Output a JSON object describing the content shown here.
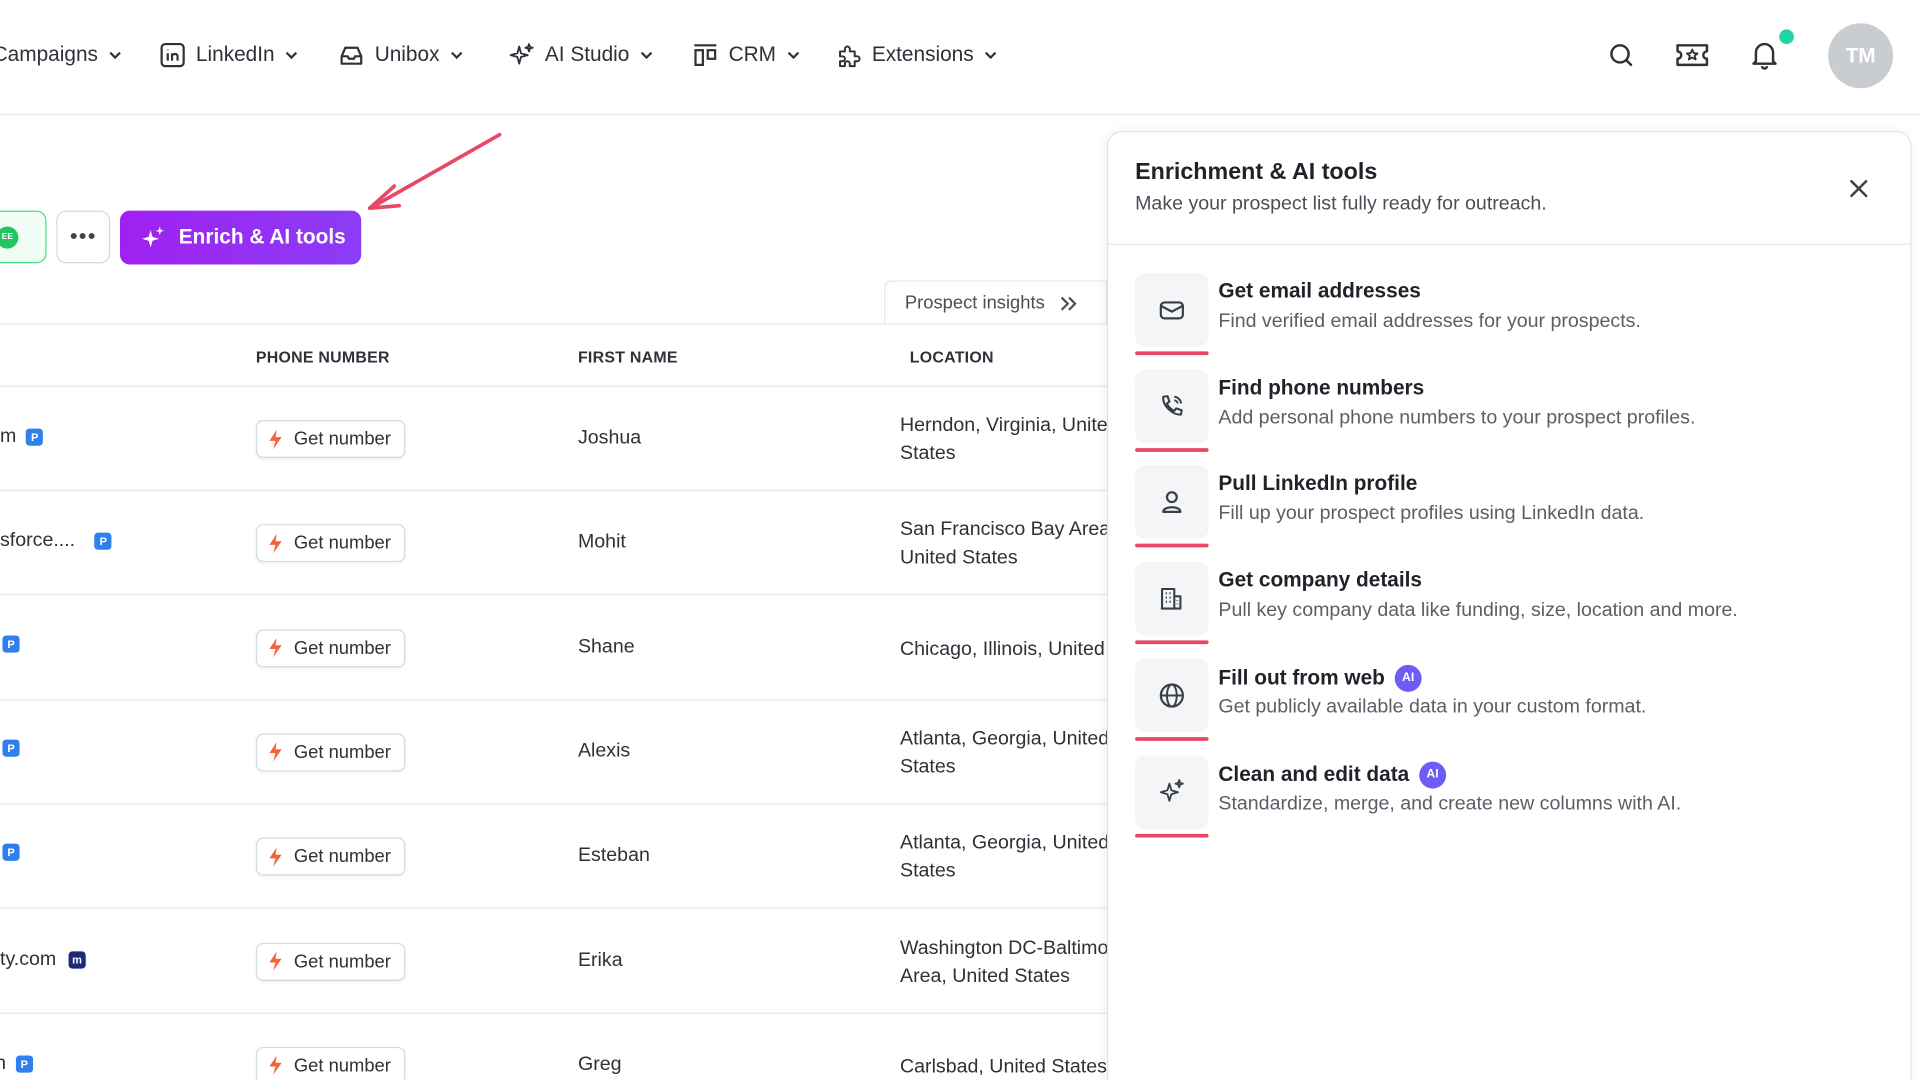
{
  "nav": {
    "items": [
      {
        "label": "Campaigns",
        "icon": "campaigns-icon"
      },
      {
        "label": "LinkedIn",
        "icon": "linkedin-icon"
      },
      {
        "label": "Unibox",
        "icon": "inbox-icon"
      },
      {
        "label": "AI Studio",
        "icon": "sparkles-icon"
      },
      {
        "label": "CRM",
        "icon": "crm-icon"
      },
      {
        "label": "Extensions",
        "icon": "puzzle-icon"
      }
    ],
    "avatar_initials": "TM"
  },
  "toolbar": {
    "green_badge_label": "EE",
    "more_label": "•••",
    "enrich_label": "Enrich & AI tools",
    "insights_label": "Prospect insights"
  },
  "table": {
    "headers": {
      "phone": "PHONE NUMBER",
      "first": "FIRST NAME",
      "location": "LOCATION"
    },
    "get_number_label": "Get number",
    "rows": [
      {
        "email": "m",
        "badge": "P",
        "first": "Joshua",
        "location": "Herndon, Virginia, United\nStates"
      },
      {
        "email": "sforce....",
        "badge": "P",
        "first": "Mohit",
        "location": "San Francisco Bay Area,\nUnited States"
      },
      {
        "email": "",
        "badge": "P",
        "first": "Shane",
        "location": "Chicago, Illinois, United"
      },
      {
        "email": "",
        "badge": "P",
        "first": "Alexis",
        "location": "Atlanta, Georgia, United\nStates"
      },
      {
        "email": "",
        "badge": "P",
        "first": "Esteban",
        "location": "Atlanta, Georgia, United\nStates"
      },
      {
        "email": "ty.com",
        "badge": "m",
        "first": "Erika",
        "location": "Washington DC-Baltimore\nArea, United States"
      },
      {
        "email": "n",
        "badge": "P",
        "first": "Greg",
        "location": "Carlsbad, United States"
      }
    ]
  },
  "panel": {
    "title": "Enrichment & AI tools",
    "subtitle": "Make your prospect list fully ready for outreach.",
    "tools": [
      {
        "title": "Get email addresses",
        "desc": "Find verified email addresses for your prospects.",
        "icon": "envelope-icon",
        "ai": false
      },
      {
        "title": "Find phone numbers",
        "desc": "Add personal phone numbers to your prospect profiles.",
        "icon": "phone-icon",
        "ai": false
      },
      {
        "title": "Pull LinkedIn profile",
        "desc": "Fill up your prospect profiles using LinkedIn data.",
        "icon": "person-icon",
        "ai": false
      },
      {
        "title": "Get company details",
        "desc": "Pull key company data like funding, size, location and more.",
        "icon": "building-icon",
        "ai": false
      },
      {
        "title": "Fill out from web",
        "desc": "Get publicly available data in your custom format.",
        "icon": "globe-icon",
        "ai": true
      },
      {
        "title": "Clean and edit data",
        "desc": "Standardize, merge, and create new columns with AI.",
        "icon": "sparkles-icon",
        "ai": true
      }
    ],
    "ai_badge_label": "AI"
  },
  "colors": {
    "accent_purple": "#a020f0",
    "arrow_red": "#e84766",
    "notif_green": "#22d3a6"
  }
}
